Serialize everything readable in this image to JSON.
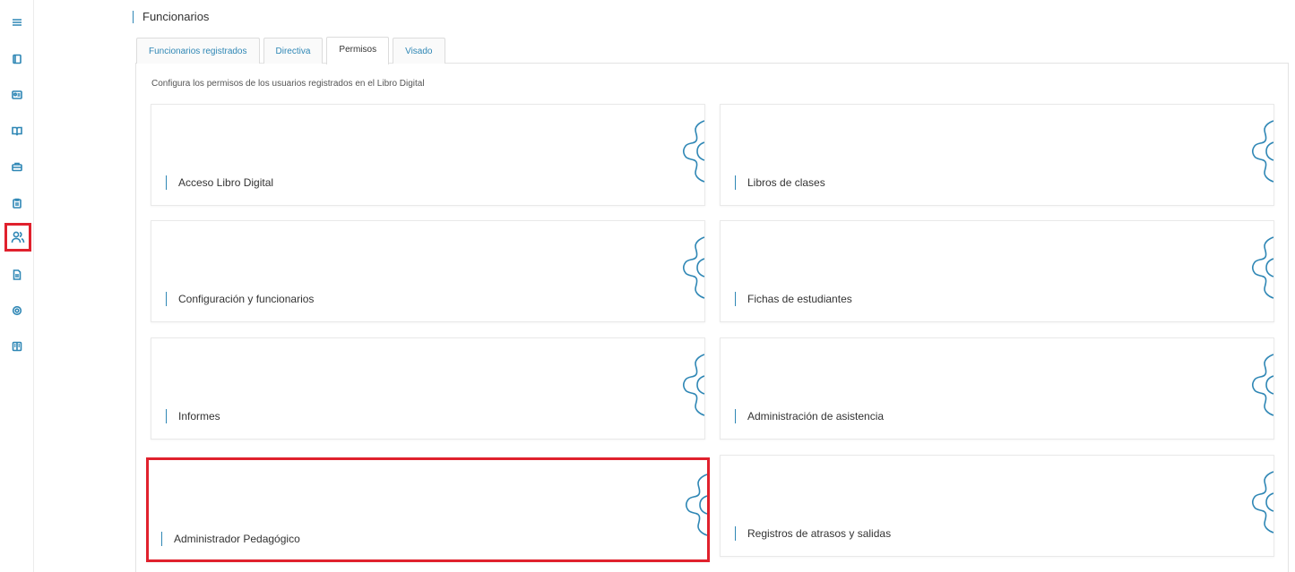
{
  "sidebar": {
    "items": [
      {
        "name": "menu-icon"
      },
      {
        "name": "book-icon"
      },
      {
        "name": "id-card-icon"
      },
      {
        "name": "open-book-icon"
      },
      {
        "name": "briefcase-icon"
      },
      {
        "name": "clipboard-icon"
      },
      {
        "name": "users-icon",
        "active": true
      },
      {
        "name": "document-icon"
      },
      {
        "name": "settings-icon"
      },
      {
        "name": "notebook-icon"
      }
    ],
    "accent": "#2f87b5",
    "highlight": "#e0212d"
  },
  "header": {
    "title": "Funcionarios"
  },
  "tabs": [
    {
      "label": "Funcionarios registrados"
    },
    {
      "label": "Directiva"
    },
    {
      "label": "Permisos",
      "active": true
    },
    {
      "label": "Visado"
    }
  ],
  "main": {
    "description": "Configura los permisos de los usuarios registrados en el Libro Digital",
    "cards": [
      {
        "label": "Acceso Libro Digital",
        "icon": "gear-icon"
      },
      {
        "label": "Libros de clases",
        "icon": "gear-icon"
      },
      {
        "label": "Configuración y funcionarios",
        "icon": "gear-icon"
      },
      {
        "label": "Fichas de estudiantes",
        "icon": "gear-icon"
      },
      {
        "label": "Informes",
        "icon": "gear-icon"
      },
      {
        "label": "Administración de asistencia",
        "icon": "gear-icon"
      },
      {
        "label": "Administrador Pedagógico",
        "icon": "gear-icon",
        "highlighted": true
      },
      {
        "label": "Registros de atrasos y salidas",
        "icon": "gear-icon"
      }
    ]
  }
}
